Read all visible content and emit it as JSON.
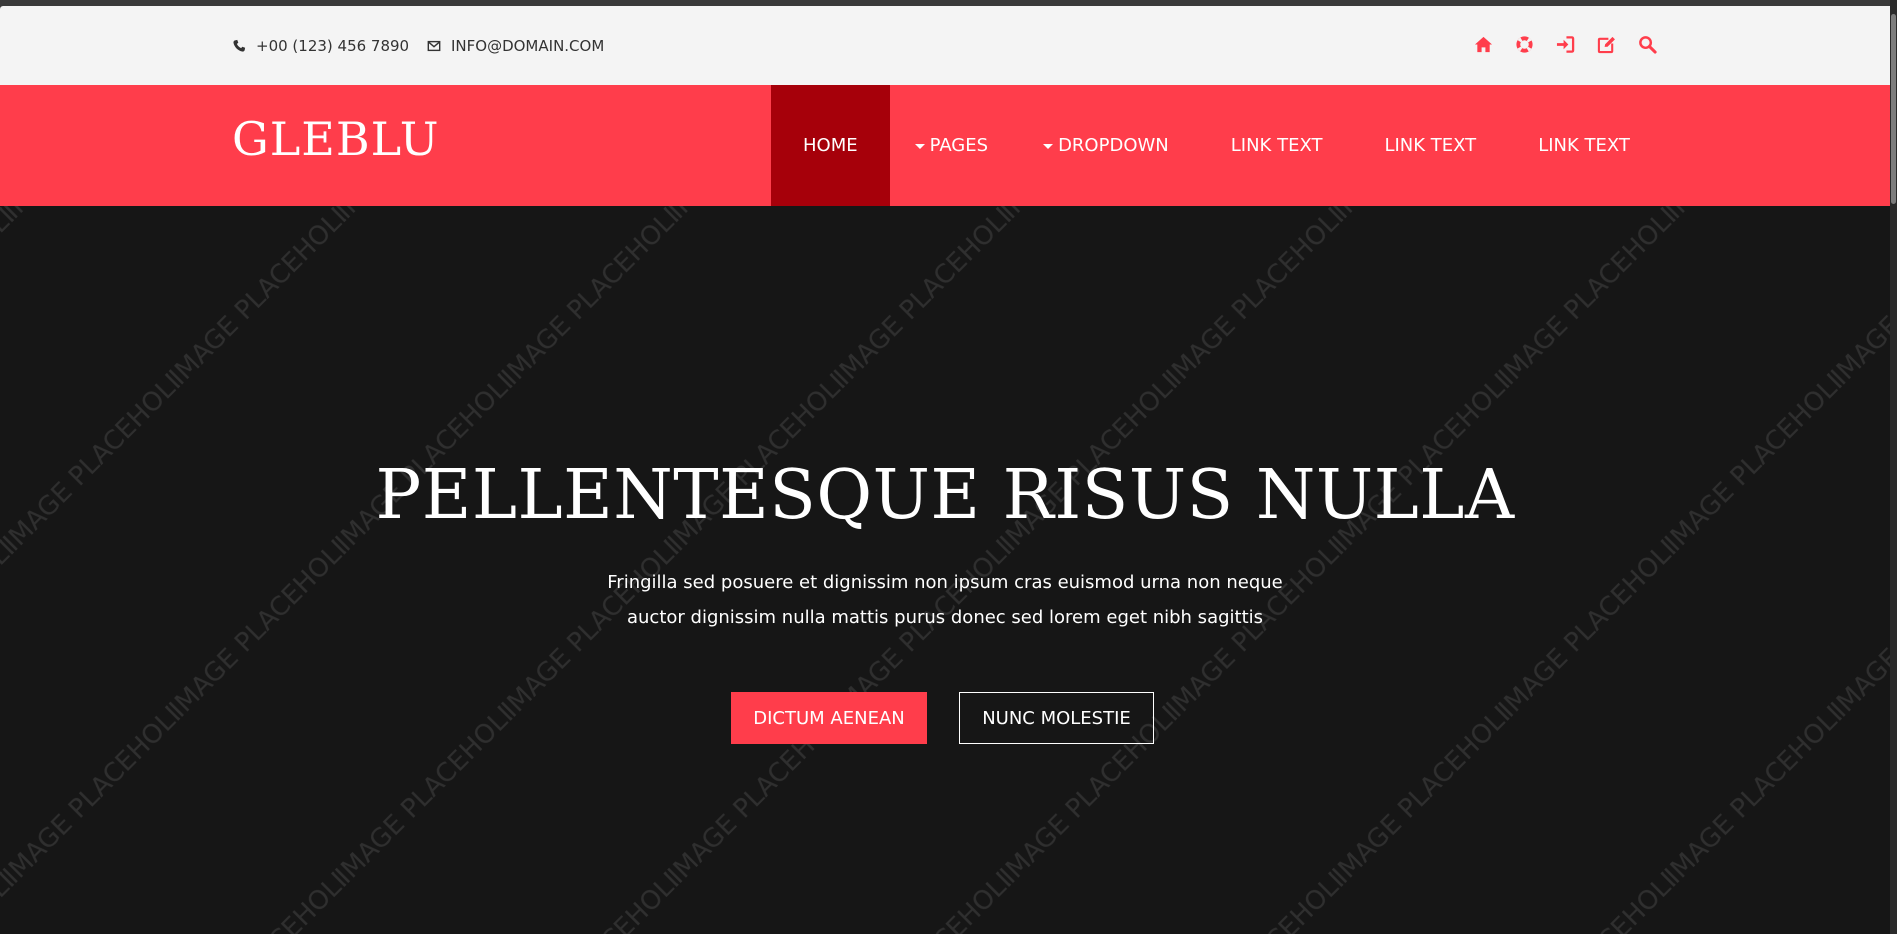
{
  "topbar": {
    "phone": "+00 (123) 456 7890",
    "email": "INFO@DOMAIN.COM",
    "icons": [
      "home-icon",
      "lifebuoy-icon",
      "sign-in-icon",
      "edit-icon",
      "search-icon"
    ]
  },
  "brand": {
    "logo": "GLEBLU"
  },
  "nav": {
    "items": [
      {
        "label": "HOME",
        "active": true
      },
      {
        "label": "PAGES",
        "dropdown": true
      },
      {
        "label": "DROPDOWN",
        "dropdown": true
      },
      {
        "label": "LINK TEXT"
      },
      {
        "label": "LINK TEXT"
      },
      {
        "label": "LINK TEXT"
      }
    ]
  },
  "hero": {
    "background_label": "IMAGE PLACEHOLDER",
    "title": "PELLENTESQUE RISUS NULLA",
    "lines": [
      "Fringilla sed posuere et dignissim non ipsum cras euismod urna non neque",
      "auctor dignissim nulla mattis purus donec sed lorem eget nibh sagittis"
    ],
    "primary_button": "DICTUM AENEAN",
    "secondary_button": "NUNC MOLESTIE"
  },
  "colors": {
    "accent": "#ff3d4b",
    "active_nav": "#a6000a",
    "topbar": "#f4f4f4",
    "hero_bg": "#161616"
  }
}
